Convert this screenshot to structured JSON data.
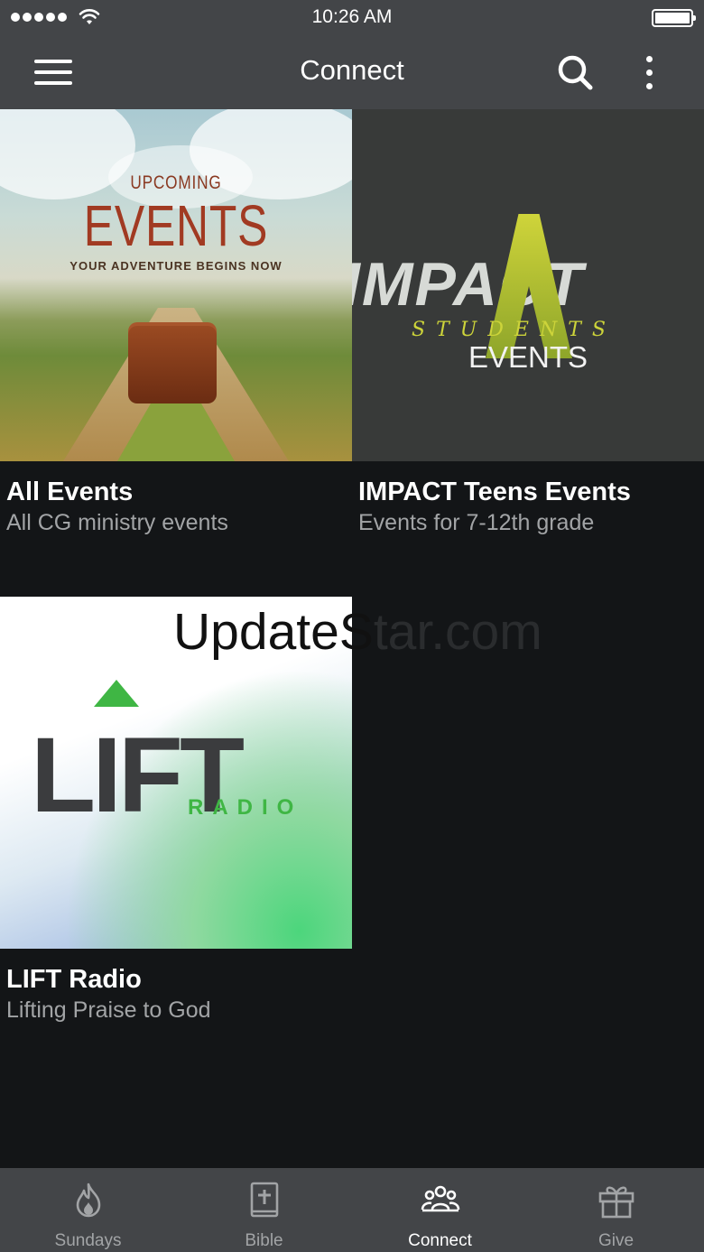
{
  "status_bar": {
    "time": "10:26 AM"
  },
  "nav": {
    "title": "Connect",
    "icons": [
      "hamburger-menu-icon",
      "search-icon",
      "more-vertical-icon"
    ]
  },
  "tiles": [
    {
      "title": "All Events",
      "subtitle": "All CG ministry events",
      "image": {
        "pretitle": "UPCOMING",
        "title": "EVENTS",
        "tagline": "YOUR ADVENTURE BEGINS NOW"
      }
    },
    {
      "title": "IMPACT Teens Events",
      "subtitle": "Events for 7-12th grade",
      "image": {
        "brand": "IMPACT",
        "line1": "STUDENTS",
        "line2": "EVENTS"
      }
    },
    {
      "title": "LIFT Radio",
      "subtitle": "Lifting Praise to God",
      "image": {
        "brand": "LIFT",
        "sub": "RADIO"
      }
    }
  ],
  "watermark": {
    "text_dark": "UpdateS",
    "text_dim": "tar.com"
  },
  "tab_bar": {
    "active": "Connect",
    "tabs": [
      {
        "label": "Sundays",
        "icon": "flame-icon"
      },
      {
        "label": "Bible",
        "icon": "bible-icon"
      },
      {
        "label": "Connect",
        "icon": "people-icon"
      },
      {
        "label": "Give",
        "icon": "gift-icon"
      }
    ]
  },
  "colors": {
    "bar_background": "#434548",
    "content_background": "#131517",
    "subtitle_text": "#a2a4a6"
  }
}
